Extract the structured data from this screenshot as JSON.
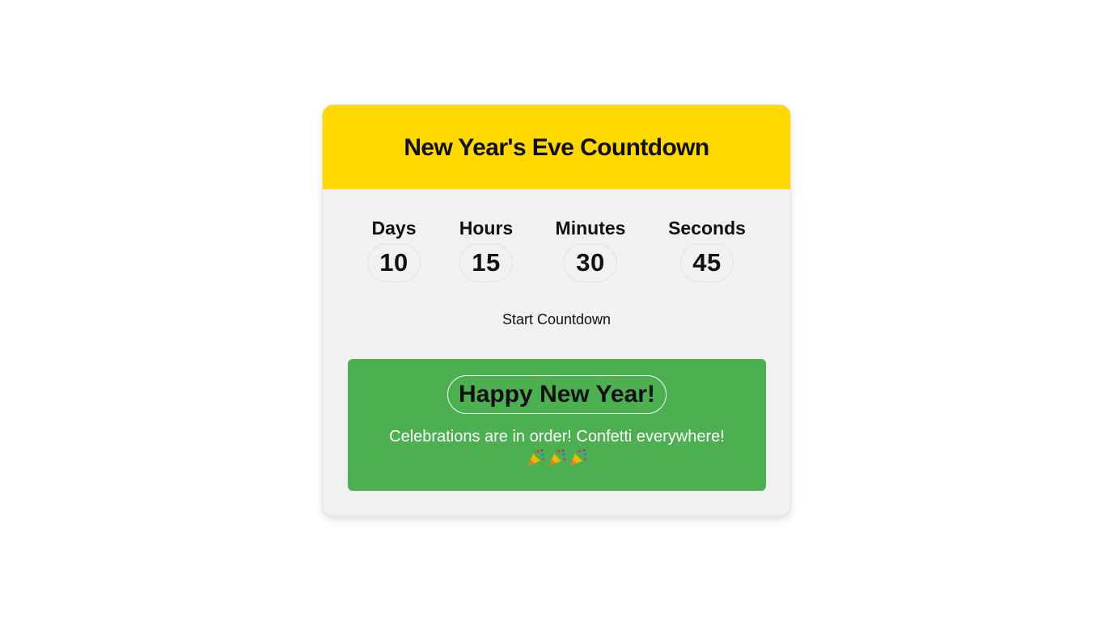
{
  "header": {
    "title": "New Year's Eve Countdown"
  },
  "countdown": {
    "units": [
      {
        "label": "Days",
        "value": "10"
      },
      {
        "label": "Hours",
        "value": "15"
      },
      {
        "label": "Minutes",
        "value": "30"
      },
      {
        "label": "Seconds",
        "value": "45"
      }
    ]
  },
  "controls": {
    "start_label": "Start Countdown"
  },
  "celebration": {
    "title": "Happy New Year!",
    "message": "Celebrations are in order! Confetti everywhere!",
    "confetti_icons": [
      "party-popper-icon",
      "party-popper-icon",
      "party-popper-icon"
    ]
  },
  "colors": {
    "header_bg": "#ffd800",
    "card_bg": "#f1f1f1",
    "celebration_bg": "#4caf50",
    "celebration_text": "#ffffff"
  }
}
